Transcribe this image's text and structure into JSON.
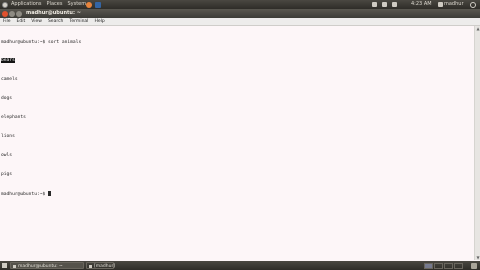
{
  "top_panel": {
    "menus": [
      "Applications",
      "Places",
      "System"
    ],
    "clock": "4:23 AM",
    "user": "madhur"
  },
  "window": {
    "title": "madhur@ubuntu: ~"
  },
  "menubar": [
    "File",
    "Edit",
    "View",
    "Search",
    "Terminal",
    "Help"
  ],
  "terminal": {
    "prompt": "madhur@ubuntu:~$ ",
    "command": "sort animals",
    "output": [
      "bears",
      "camels",
      "dogs",
      "elephants",
      "lions",
      "owls",
      "pigs"
    ],
    "final_prompt": "madhur@ubuntu:~$ "
  },
  "bottom_panel": {
    "tasks": [
      "madhur@ubuntu: ~",
      "[madhur]"
    ]
  },
  "colors": {
    "terminal_bg": "#fdf6f8",
    "panel_bg": "#3c3b37",
    "close_button": "#e0512d"
  }
}
